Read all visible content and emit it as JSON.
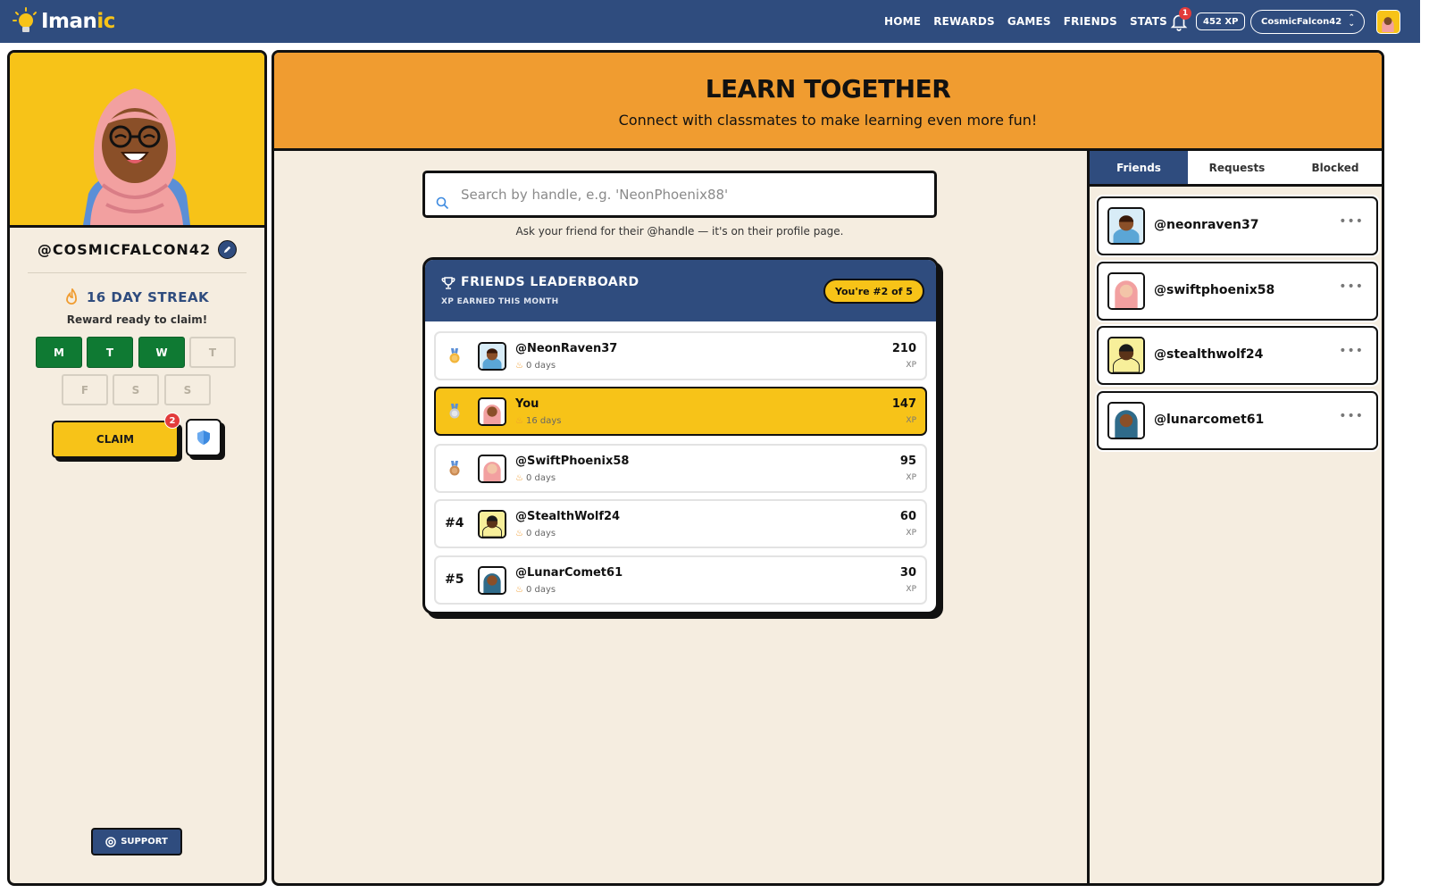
{
  "app": {
    "logo_main": "Iman",
    "logo_accent": "ic"
  },
  "nav": [
    {
      "label": "HOME"
    },
    {
      "label": "REWARDS"
    },
    {
      "label": "GAMES"
    },
    {
      "label": "FRIENDS"
    },
    {
      "label": "STATS"
    }
  ],
  "header": {
    "notifications": "1",
    "xp": "452 XP",
    "username": "CosmicFalcon42"
  },
  "profile": {
    "handle": "@COSMICFALCON42",
    "streak": "16 DAY STREAK",
    "reward_text": "Reward ready to claim!",
    "days": [
      {
        "label": "M",
        "done": true
      },
      {
        "label": "T",
        "done": true
      },
      {
        "label": "W",
        "done": true
      },
      {
        "label": "T",
        "done": false
      },
      {
        "label": "F",
        "done": false
      },
      {
        "label": "S",
        "done": false
      },
      {
        "label": "S",
        "done": false
      }
    ],
    "claim_label": "CLAIM",
    "claim_badge": "2",
    "support_label": "SUPPORT"
  },
  "banner": {
    "title": "LEARN TOGETHER",
    "subtitle": "Connect with classmates to make learning even more fun!"
  },
  "search": {
    "placeholder": "Search by handle, e.g. 'NeonPhoenix88'",
    "value": "",
    "help": "Ask your friend for their @handle — it's on their profile page."
  },
  "leaderboard": {
    "title": "FRIENDS LEADERBOARD",
    "subtitle": "XP EARNED THIS MONTH",
    "rank_badge": "You're #2 of 5",
    "xp_unit": "XP",
    "rows": [
      {
        "rank": "",
        "medal": "gold-medal-icon",
        "name": "@NeonRaven37",
        "days": "0 days",
        "xp": "210",
        "me": false
      },
      {
        "rank": "",
        "medal": "silver-medal-icon",
        "name": "You",
        "days": "16 days",
        "xp": "147",
        "me": true
      },
      {
        "rank": "",
        "medal": "bronze-medal-icon",
        "name": "@SwiftPhoenix58",
        "days": "0 days",
        "xp": "95",
        "me": false
      },
      {
        "rank": "#4",
        "medal": "",
        "name": "@StealthWolf24",
        "days": "0 days",
        "xp": "60",
        "me": false
      },
      {
        "rank": "#5",
        "medal": "",
        "name": "@LunarComet61",
        "days": "0 days",
        "xp": "30",
        "me": false
      }
    ]
  },
  "friends_panel": {
    "tabs": [
      {
        "label": "Friends",
        "active": true
      },
      {
        "label": "Requests",
        "active": false
      },
      {
        "label": "Blocked",
        "active": false
      }
    ],
    "friends": [
      {
        "handle": "@neonraven37"
      },
      {
        "handle": "@swiftphoenix58"
      },
      {
        "handle": "@stealthwolf24"
      },
      {
        "handle": "@lunarcomet61"
      }
    ],
    "more_label": "•••"
  },
  "colors": {
    "navy": "#2f4c7e",
    "yellow": "#f7c318",
    "orange": "#f09c30",
    "green": "#0f7a33",
    "cream": "#f5ede0"
  }
}
